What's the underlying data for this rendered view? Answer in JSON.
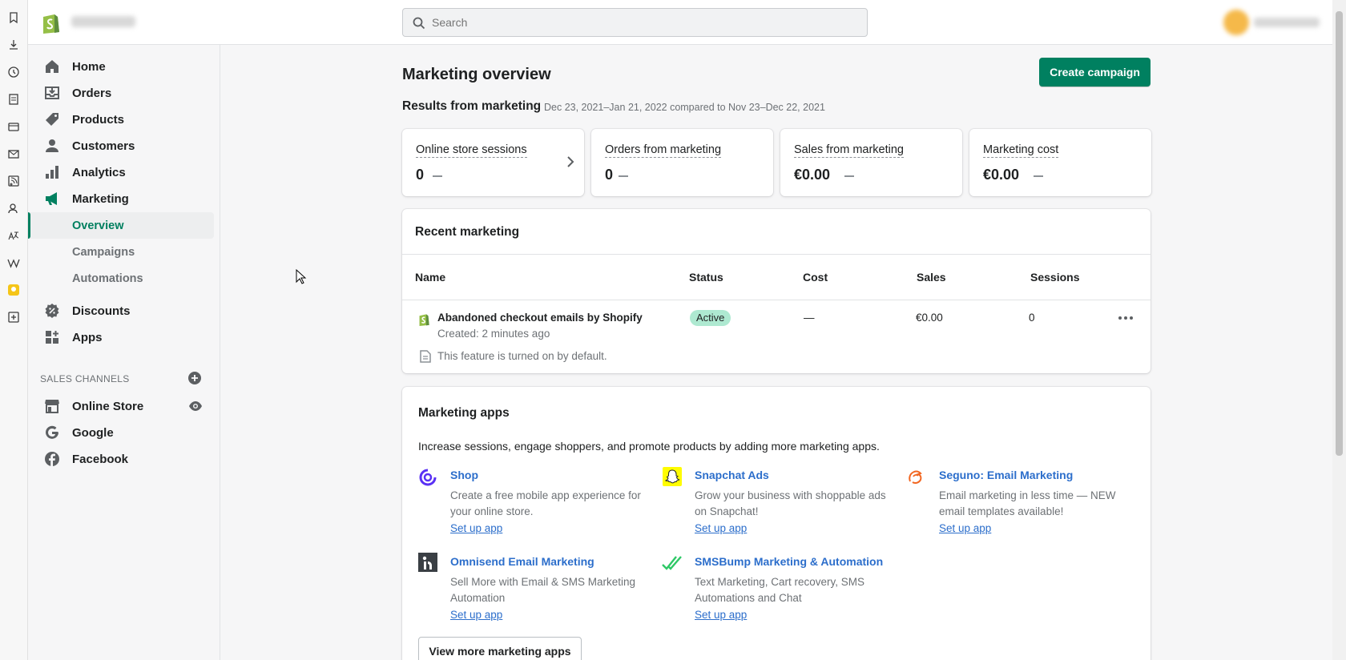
{
  "search": {
    "placeholder": "Search"
  },
  "sidebar": {
    "items": [
      {
        "label": "Home"
      },
      {
        "label": "Orders"
      },
      {
        "label": "Products"
      },
      {
        "label": "Customers"
      },
      {
        "label": "Analytics"
      },
      {
        "label": "Marketing"
      },
      {
        "label": "Discounts"
      },
      {
        "label": "Apps"
      }
    ],
    "sub_items": [
      {
        "label": "Overview"
      },
      {
        "label": "Campaigns"
      },
      {
        "label": "Automations"
      }
    ],
    "sales_channels_heading": "SALES CHANNELS",
    "channels": [
      {
        "label": "Online Store"
      },
      {
        "label": "Google"
      },
      {
        "label": "Facebook"
      }
    ]
  },
  "main": {
    "title": "Marketing overview",
    "create_button": "Create campaign",
    "results_heading": "Results from marketing",
    "results_dates": "Dec 23, 2021–Jan 21, 2022 compared to Nov 23–Dec 22, 2021",
    "metrics": [
      {
        "label": "Online store sessions",
        "value": "0"
      },
      {
        "label": "Orders from marketing",
        "value": "0"
      },
      {
        "label": "Sales from marketing",
        "value": "€0.00"
      },
      {
        "label": "Marketing cost",
        "value": "€0.00"
      }
    ],
    "recent": {
      "title": "Recent marketing",
      "columns": [
        "Name",
        "Status",
        "Cost",
        "Sales",
        "Sessions"
      ],
      "row": {
        "name": "Abandoned checkout emails by Shopify",
        "created": "Created: 2 minutes ago",
        "status": "Active",
        "cost": "—",
        "sales": "€0.00",
        "sessions": "0",
        "note": "This feature is turned on by default."
      }
    },
    "apps": {
      "title": "Marketing apps",
      "intro": "Increase sessions, engage shoppers, and promote products by adding more marketing apps.",
      "setup_label": "Set up app",
      "list": [
        {
          "name": "Shop",
          "desc": "Create a free mobile app experience for your online store."
        },
        {
          "name": "Snapchat Ads",
          "desc": "Grow your business with shoppable ads on Snapchat!"
        },
        {
          "name": "Seguno: Email Marketing",
          "desc": "Email marketing in less time — NEW email templates available!"
        },
        {
          "name": "Omnisend Email Marketing",
          "desc": "Sell More with Email & SMS Marketing Automation"
        },
        {
          "name": "SMSBump Marketing & Automation",
          "desc": "Text Marketing, Cart recovery, SMS Automations and Chat"
        }
      ],
      "view_more": "View more marketing apps"
    }
  },
  "colors": {
    "accent": "#008060",
    "link": "#2c6ecb",
    "badge_success": "#aee9d1"
  }
}
